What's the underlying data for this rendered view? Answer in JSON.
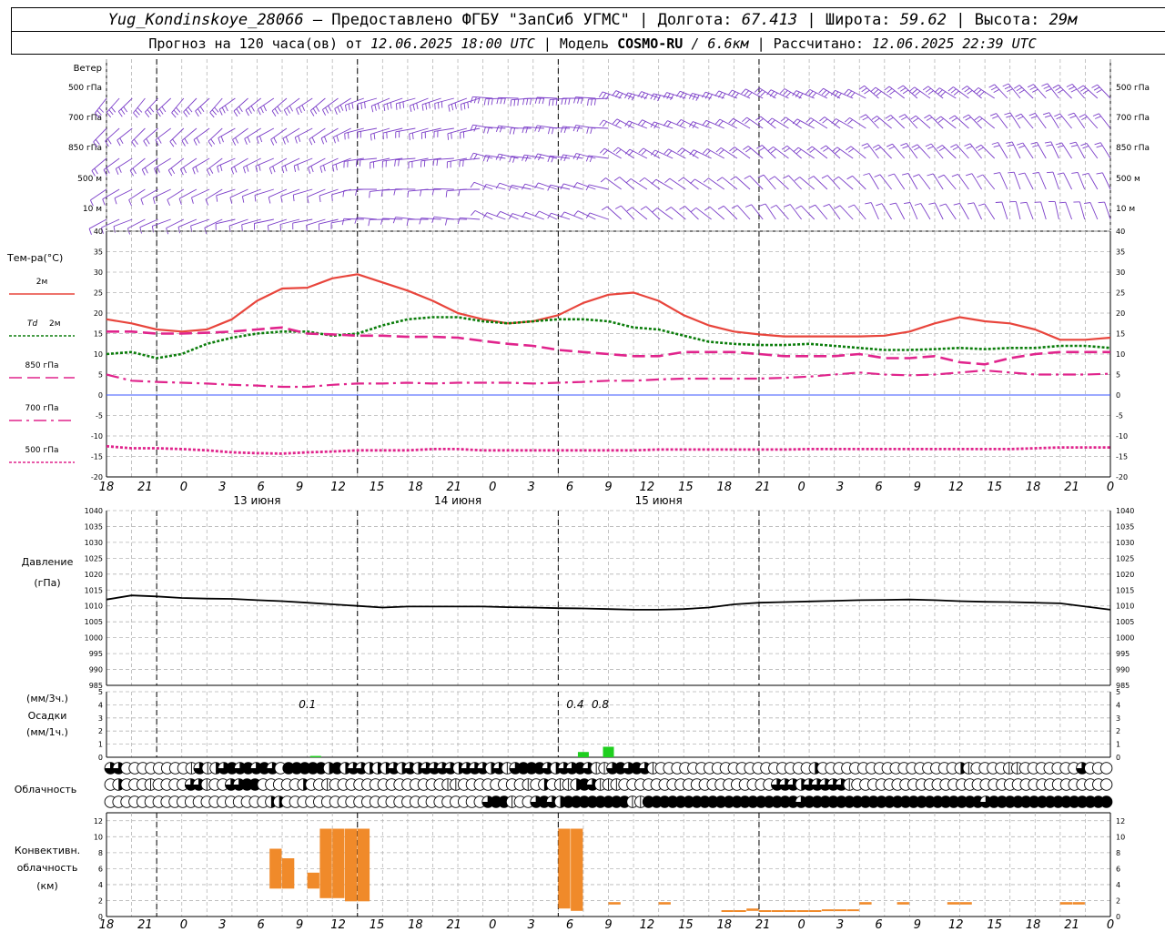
{
  "header": {
    "station": "Yug_Kondinskoye_28066",
    "provider": "– Предоставлено ФГБУ \"ЗапСиб УГМС\"",
    "lon_label": "Долгота:",
    "lon_value": "67.413",
    "lat_label": "Широта:",
    "lat_value": "59.62",
    "alt_label": "Высота:",
    "alt_value": "29м",
    "forecast_label": "Прогноз на 120 часа(ов) от",
    "forecast_start": "12.06.2025 18:00 UTC",
    "model_label": "| Модель",
    "model_name": "COSMO-RU",
    "model_res": "/ 6.6км",
    "calc_label": "| Рассчитано:",
    "calc_time": "12.06.2025 22:39 UTC"
  },
  "chart_data": [
    {
      "type": "wind_barbs",
      "label": "Ветер",
      "levels": [
        "500 гПа",
        "700 гПа",
        "850 гПа",
        "500 м",
        "10 м"
      ],
      "direction_deg_by_period": [
        220,
        230,
        250,
        270,
        290,
        300,
        310,
        320
      ],
      "speed_ms_by_level": [
        15,
        12,
        9,
        6,
        3
      ]
    },
    {
      "type": "line",
      "ylabel": "Тем-ра(°С)",
      "ylim": [
        -20,
        40
      ],
      "yticks": [
        -20,
        -15,
        -10,
        -5,
        0,
        5,
        10,
        15,
        20,
        25,
        30,
        35,
        40
      ],
      "x_hours": [
        0,
        3,
        6,
        9,
        12,
        15,
        18,
        21,
        24,
        27,
        30,
        33,
        36,
        39,
        42,
        45,
        48,
        51,
        54,
        57,
        60,
        63,
        66,
        69,
        72,
        75,
        78,
        81,
        84,
        87,
        90,
        93,
        96,
        99,
        102,
        105,
        108,
        111,
        114,
        117,
        120
      ],
      "series": [
        {
          "name": "2м",
          "color": "#e8453c",
          "style": "solid",
          "values": [
            18.5,
            17.5,
            16,
            15.5,
            16,
            18.5,
            23,
            26,
            26.2,
            28.5,
            29.5,
            27.5,
            25.5,
            23,
            20,
            18.5,
            17.5,
            18,
            19.5,
            22.5,
            24.5,
            25,
            23,
            19.5,
            17,
            15.5,
            14.8,
            14.3,
            14.3,
            14.3,
            14.3,
            14.5,
            15.5,
            17.5,
            19,
            18,
            17.5,
            16,
            13.5,
            13.5,
            14
          ]
        },
        {
          "name": "Td 2м",
          "color": "#0b7d0b",
          "style": "dotted",
          "values": [
            10,
            10.5,
            9,
            10,
            12.5,
            14,
            15,
            15.5,
            15.5,
            14.5,
            15,
            17,
            18.5,
            19,
            19,
            18,
            17.5,
            18,
            18.5,
            18.5,
            18,
            16.5,
            16,
            14.5,
            13,
            12.5,
            12.2,
            12.2,
            12.5,
            12,
            11.5,
            11,
            11,
            11.2,
            11.5,
            11.2,
            11.5,
            11.5,
            12,
            12,
            11.5
          ]
        },
        {
          "name": "850 гПа",
          "color": "#e0248c",
          "style": "dashed",
          "values": [
            15.5,
            15.5,
            15,
            15,
            15.2,
            15.5,
            16,
            16.5,
            15,
            14.8,
            14.5,
            14.5,
            14.2,
            14.2,
            14,
            13.2,
            12.5,
            12,
            11,
            10.5,
            10,
            9.5,
            9.5,
            10.5,
            10.5,
            10.5,
            10,
            9.5,
            9.5,
            9.5,
            10,
            9,
            9,
            9.5,
            8,
            7.5,
            9,
            10,
            10.5,
            10.5,
            10.5
          ]
        },
        {
          "name": "700 гПа",
          "color": "#e0248c",
          "style": "dashdot",
          "values": [
            5,
            3.5,
            3.2,
            3,
            2.8,
            2.5,
            2.3,
            2,
            2,
            2.5,
            2.8,
            2.8,
            3,
            2.8,
            3,
            3,
            3,
            2.8,
            3,
            3.2,
            3.5,
            3.5,
            3.8,
            4,
            4,
            4,
            4,
            4.2,
            4.5,
            5,
            5.5,
            5,
            4.8,
            5,
            5.5,
            6,
            5.5,
            5,
            5,
            5,
            5.2
          ]
        },
        {
          "name": "500 гПа",
          "color": "#e0248c",
          "style": "dotted",
          "values": [
            -12.5,
            -13,
            -13,
            -13.2,
            -13.5,
            -14,
            -14.2,
            -14.3,
            -14,
            -13.8,
            -13.5,
            -13.5,
            -13.5,
            -13.2,
            -13.2,
            -13.5,
            -13.5,
            -13.5,
            -13.5,
            -13.5,
            -13.5,
            -13.5,
            -13.3,
            -13.3,
            -13.3,
            -13.3,
            -13.3,
            -13.3,
            -13.2,
            -13.2,
            -13.2,
            -13.2,
            -13.2,
            -13.2,
            -13.2,
            -13.2,
            -13.2,
            -13,
            -12.8,
            -12.8,
            -12.8
          ]
        }
      ]
    },
    {
      "type": "line",
      "ylabel": "Давление",
      "ylabel2": "(гПа)",
      "ylim": [
        985,
        1040
      ],
      "yticks": [
        985,
        990,
        995,
        1000,
        1005,
        1010,
        1015,
        1020,
        1025,
        1030,
        1035,
        1040
      ],
      "series": [
        {
          "name": "Давление",
          "color": "#000000",
          "values": [
            1012,
            1013.3,
            1013,
            1012.5,
            1012.3,
            1012.2,
            1011.8,
            1011.5,
            1011,
            1010.5,
            1010,
            1009.5,
            1009.8,
            1009.8,
            1009.8,
            1009.8,
            1009.6,
            1009.5,
            1009.3,
            1009.2,
            1009,
            1008.8,
            1008.8,
            1009,
            1009.5,
            1010.5,
            1011,
            1011.2,
            1011.4,
            1011.6,
            1011.8,
            1011.9,
            1012,
            1011.8,
            1011.5,
            1011.3,
            1011.2,
            1011,
            1010.8,
            1009.8,
            1008.8
          ]
        }
      ]
    },
    {
      "type": "bar",
      "ylabel": "Осадки",
      "ylabel_top": "(мм/3ч.)",
      "ylabel_bottom": "(мм/1ч.)",
      "ylim": [
        0,
        5
      ],
      "yticks": [
        0,
        1,
        2,
        3,
        4,
        5
      ],
      "bars": [
        {
          "hour": 25,
          "value": 0.1
        },
        {
          "hour": 57,
          "value": 0.4
        },
        {
          "hour": 60,
          "value": 0.8
        }
      ],
      "data_labels": [
        {
          "hour": 25,
          "text": "0.1"
        },
        {
          "hour": 57,
          "text": "0.4"
        },
        {
          "hour": 60,
          "text": "0.8"
        }
      ],
      "color": "#1fcf1f"
    },
    {
      "type": "table",
      "label": "Облачность",
      "legend": "okta symbols: 0=clear .. 8=overcast",
      "rows": [
        [
          6,
          6,
          0,
          0,
          0,
          0,
          0,
          0,
          0,
          0,
          2,
          6,
          2,
          4,
          6,
          8,
          6,
          8,
          6,
          8,
          6,
          0,
          8,
          8,
          8,
          8,
          8,
          4,
          8,
          4,
          6,
          6,
          4,
          4,
          4,
          6,
          4,
          6,
          4,
          6,
          6,
          6,
          6,
          4,
          6,
          6,
          6,
          4,
          6,
          2,
          6,
          8,
          8,
          8,
          6,
          4,
          6,
          6,
          8,
          6,
          2,
          2,
          6,
          8,
          6,
          8,
          6,
          2,
          0,
          0,
          0,
          0,
          0,
          0,
          0,
          0,
          0,
          0,
          0,
          0,
          0,
          0,
          0,
          0,
          0,
          0,
          0,
          4,
          0,
          0,
          0,
          0,
          0,
          0,
          0,
          0,
          0,
          0,
          0,
          0,
          0,
          0,
          0,
          0,
          0,
          4,
          2,
          0,
          0,
          0,
          0,
          2,
          2,
          0,
          0,
          0,
          0,
          0,
          0,
          0,
          6,
          0,
          0,
          0
        ],
        [
          0,
          4,
          0,
          0,
          0,
          2,
          0,
          0,
          0,
          0,
          6,
          6,
          2,
          0,
          0,
          6,
          6,
          8,
          8,
          0,
          0,
          0,
          0,
          0,
          4,
          0,
          0,
          2,
          0,
          0,
          0,
          0,
          0,
          0,
          0,
          0,
          0,
          0,
          0,
          0,
          0,
          0,
          2,
          2,
          0,
          0,
          0,
          0,
          0,
          0,
          0,
          0,
          2,
          0,
          4,
          0,
          2,
          2,
          4,
          8,
          6,
          2,
          2,
          2,
          0,
          0,
          0,
          0,
          0,
          0,
          0,
          0,
          0,
          0,
          0,
          0,
          0,
          0,
          0,
          0,
          0,
          0,
          0,
          6,
          6,
          6,
          4,
          6,
          6,
          6,
          6,
          6,
          2,
          0,
          0,
          0,
          0,
          0,
          0,
          0,
          0,
          0,
          0,
          0,
          0,
          0,
          0,
          0,
          0,
          0,
          0,
          0,
          0,
          0,
          0,
          0,
          0,
          0,
          0,
          0,
          0,
          0,
          0,
          0,
          0
        ],
        [
          0,
          0,
          0,
          0,
          0,
          0,
          0,
          0,
          0,
          0,
          0,
          0,
          0,
          0,
          0,
          0,
          0,
          0,
          0,
          0,
          4,
          4,
          0,
          0,
          0,
          0,
          0,
          0,
          0,
          0,
          0,
          0,
          0,
          0,
          0,
          0,
          0,
          0,
          0,
          0,
          0,
          0,
          0,
          0,
          0,
          0,
          0,
          6,
          8,
          8,
          2,
          0,
          0,
          6,
          8,
          6,
          4,
          8,
          8,
          8,
          8,
          8,
          8,
          8,
          8,
          2,
          2,
          8,
          8,
          8,
          8,
          8,
          8,
          8,
          8,
          8,
          8,
          8,
          8,
          8,
          8,
          8,
          8,
          8,
          8,
          8,
          6,
          8,
          8,
          8,
          8,
          8,
          8,
          8,
          8,
          8,
          8,
          8,
          8,
          8,
          8,
          8,
          8,
          8,
          8,
          8,
          8,
          8,
          8,
          6,
          8,
          8,
          8,
          8,
          8,
          8,
          8,
          8,
          8,
          8,
          8,
          8,
          8,
          8,
          8
        ]
      ]
    },
    {
      "type": "bar",
      "ylabel": "Конвективн.",
      "ylabel2": "облачность",
      "ylabel3": "(км)",
      "ylim": [
        0,
        13
      ],
      "yticks": [
        0,
        2,
        4,
        6,
        8,
        10,
        12
      ],
      "color": "#f08a2a",
      "bars": [
        {
          "hour": 13,
          "base": 3.5,
          "top": 8.5
        },
        {
          "hour": 14,
          "base": 3.5,
          "top": 7.3
        },
        {
          "hour": 16,
          "base": 3.5,
          "top": 5.5
        },
        {
          "hour": 17,
          "base": 2.3,
          "top": 11
        },
        {
          "hour": 18,
          "base": 2.3,
          "top": 11
        },
        {
          "hour": 19,
          "base": 1.9,
          "top": 11
        },
        {
          "hour": 20,
          "base": 1.9,
          "top": 11
        },
        {
          "hour": 36,
          "base": 1,
          "top": 11
        },
        {
          "hour": 37,
          "base": 0.7,
          "top": 11
        },
        {
          "hour": 40,
          "base": 1.5,
          "top": 1.8
        },
        {
          "hour": 44,
          "base": 1.5,
          "top": 1.8
        },
        {
          "hour": 49,
          "base": 0.6,
          "top": 0.8
        },
        {
          "hour": 50,
          "base": 0.6,
          "top": 0.8
        },
        {
          "hour": 51,
          "base": 0.7,
          "top": 1.0
        },
        {
          "hour": 52,
          "base": 0.6,
          "top": 0.8
        },
        {
          "hour": 53,
          "base": 0.6,
          "top": 0.8
        },
        {
          "hour": 54,
          "base": 0.6,
          "top": 0.8
        },
        {
          "hour": 55,
          "base": 0.6,
          "top": 0.8
        },
        {
          "hour": 56,
          "base": 0.6,
          "top": 0.8
        },
        {
          "hour": 57,
          "base": 0.7,
          "top": 0.9
        },
        {
          "hour": 58,
          "base": 0.7,
          "top": 0.9
        },
        {
          "hour": 59,
          "base": 0.7,
          "top": 0.9
        },
        {
          "hour": 60,
          "base": 1.5,
          "top": 1.8
        },
        {
          "hour": 63,
          "base": 1.5,
          "top": 1.8
        },
        {
          "hour": 67,
          "base": 1.5,
          "top": 1.8
        },
        {
          "hour": 68,
          "base": 1.5,
          "top": 1.8
        },
        {
          "hour": 76,
          "base": 1.5,
          "top": 1.8
        },
        {
          "hour": 77,
          "base": 1.5,
          "top": 1.8
        }
      ]
    }
  ],
  "x_axis": {
    "tick_labels": [
      "18",
      "21",
      "0",
      "3",
      "6",
      "9",
      "12",
      "15",
      "18",
      "21",
      "0",
      "3",
      "6",
      "9",
      "12",
      "15",
      "18",
      "21",
      "0",
      "3",
      "6",
      "9",
      "12",
      "15",
      "18",
      "21",
      "0"
    ],
    "day_labels": [
      {
        "hour": 18,
        "text": "13 июня"
      },
      {
        "hour": 42,
        "text": "14 июня"
      },
      {
        "hour": 66,
        "text": "15 июня"
      }
    ],
    "midnight_hours": [
      6,
      30,
      54,
      78
    ]
  },
  "legend": {
    "t2m": "2м",
    "td_prefix": "Td",
    "td_suffix": "2м",
    "p850": "850 гПа",
    "p700": "700 гПа",
    "p500": "500 гПа"
  },
  "cloud_label": "Облачность"
}
